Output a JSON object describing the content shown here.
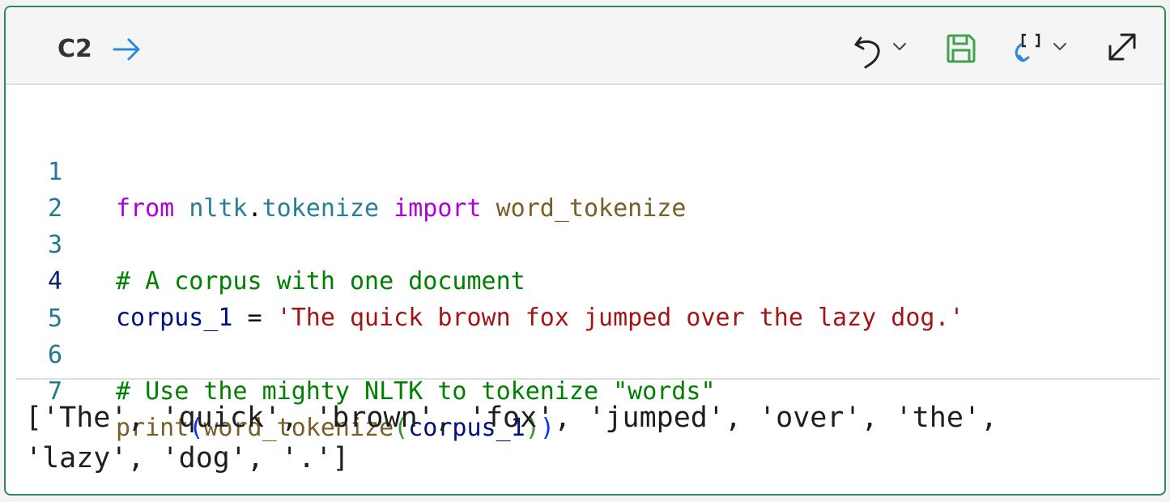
{
  "toolbar": {
    "cell_label": "C2",
    "icons": [
      "run-arrow-icon",
      "undo-icon",
      "chevron-down-icon",
      "save-icon",
      "variables-icon",
      "expand-icon"
    ],
    "colors": {
      "run_arrow": "#2f89d8",
      "save": "#3fa24f",
      "variables": "#2f89d8"
    }
  },
  "editor": {
    "lines": [
      {
        "num": "1",
        "tokens": [
          "from",
          " ",
          "nltk",
          ".",
          "tokenize",
          " ",
          "import",
          " ",
          "word_tokenize"
        ]
      },
      {
        "num": "2",
        "tokens": []
      },
      {
        "num": "3",
        "tokens": [
          "# A corpus with one document"
        ]
      },
      {
        "num": "4",
        "tokens": [
          "corpus_1",
          " = ",
          "'The quick brown fox jumped over the lazy dog.'"
        ]
      },
      {
        "num": "5",
        "tokens": []
      },
      {
        "num": "6",
        "tokens": [
          "# Use the mighty NLTK to tokenize \"words\""
        ]
      },
      {
        "num": "7",
        "tokens": [
          "print",
          "(",
          "word_tokenize",
          "(",
          "corpus_1",
          ")",
          ")"
        ]
      }
    ],
    "active_line": "4",
    "colors": {
      "keyword": "#af00db",
      "module": "#267f99",
      "function": "#795e26",
      "comment": "#008000",
      "variable": "#001080",
      "string": "#a31515",
      "line_number": "#237893"
    }
  },
  "output": {
    "text": "['The', 'quick', 'brown', 'fox', 'jumped', 'over', 'the',\n'lazy', 'dog', '.']"
  },
  "cell_border_color": "#2e8b57"
}
